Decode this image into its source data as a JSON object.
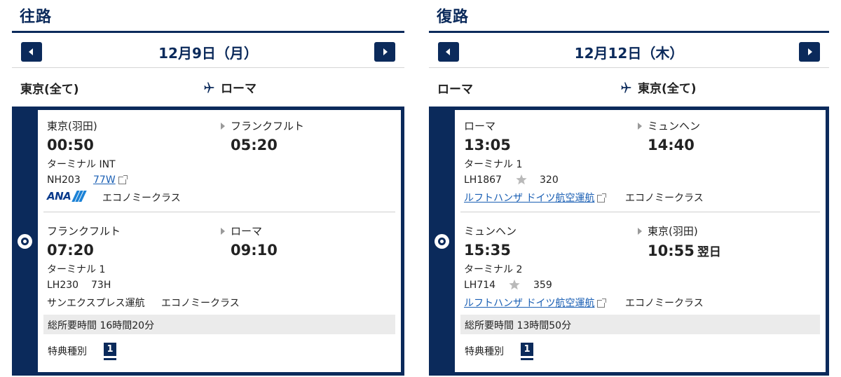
{
  "outbound": {
    "heading": "往路",
    "date": "12月9日（月）",
    "from": "東京(全て)",
    "to": "ローマ",
    "segments": [
      {
        "dep_city": "東京(羽田)",
        "arr_city": "フランクフルト",
        "dep_time": "00:50",
        "arr_time": "05:20",
        "terminal": "ターミナル INT",
        "flight": "NH203",
        "aircraft": "77W",
        "airline_logo": "ANA",
        "cabin": "エコノミークラス"
      },
      {
        "dep_city": "フランクフルト",
        "arr_city": "ローマ",
        "dep_time": "07:20",
        "arr_time": "09:10",
        "terminal": "ターミナル 1",
        "flight": "LH230",
        "aircraft": "73H",
        "operator": "サンエクスプレス運航",
        "cabin": "エコノミークラス"
      }
    ],
    "total": "総所要時間 16時間20分",
    "award_label": "特典種別",
    "award_badge": "1"
  },
  "return": {
    "heading": "復路",
    "date": "12月12日（木）",
    "from": "ローマ",
    "to": "東京(全て)",
    "segments": [
      {
        "dep_city": "ローマ",
        "arr_city": "ミュンヘン",
        "dep_time": "13:05",
        "arr_time": "14:40",
        "terminal": "ターミナル 1",
        "flight": "LH1867",
        "aircraft": "320",
        "operator_link": "ルフトハンザ ドイツ航空運航",
        "cabin": "エコノミークラス"
      },
      {
        "dep_city": "ミュンヘン",
        "arr_city": "東京(羽田)",
        "dep_time": "15:35",
        "arr_time": "10:55",
        "next_day": "翌日",
        "terminal": "ターミナル 2",
        "flight": "LH714",
        "aircraft": "359",
        "operator_link": "ルフトハンザ ドイツ航空運航",
        "cabin": "エコノミークラス"
      }
    ],
    "total": "総所要時間 13時間50分",
    "award_label": "特典種別",
    "award_badge": "1"
  },
  "colors": {
    "navy": "#0b2a5b",
    "link": "#1a5fb4",
    "ana_blue": "#1b82d6"
  }
}
